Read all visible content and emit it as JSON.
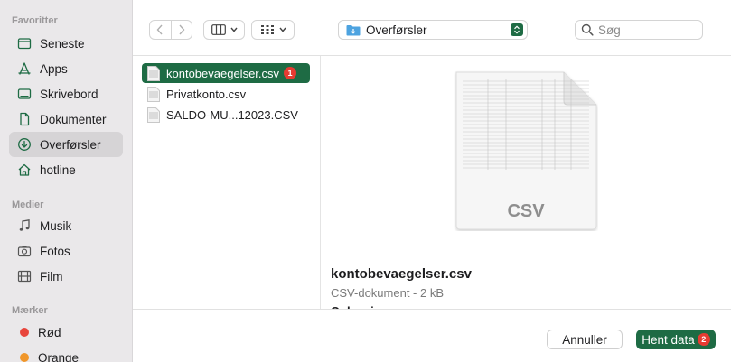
{
  "sidebar": {
    "favorites_heading": "Favoritter",
    "favorites": [
      {
        "label": "Seneste",
        "icon": "clock-folder-icon"
      },
      {
        "label": "Apps",
        "icon": "apps-icon"
      },
      {
        "label": "Skrivebord",
        "icon": "desktop-icon"
      },
      {
        "label": "Dokumenter",
        "icon": "document-icon"
      },
      {
        "label": "Overførsler",
        "icon": "downloads-icon",
        "selected": true
      },
      {
        "label": "hotline",
        "icon": "home-icon"
      }
    ],
    "media_heading": "Medier",
    "media": [
      {
        "label": "Musik",
        "icon": "music-icon"
      },
      {
        "label": "Fotos",
        "icon": "camera-icon"
      },
      {
        "label": "Film",
        "icon": "film-icon"
      }
    ],
    "tags_heading": "Mærker",
    "tags": [
      {
        "label": "Rød",
        "color": "#e8453c"
      },
      {
        "label": "Orange",
        "color": "#f0962a"
      }
    ]
  },
  "toolbar": {
    "back_icon": "chevron-left-icon",
    "forward_icon": "chevron-right-icon",
    "location": "Overførsler",
    "search_placeholder": "Søg"
  },
  "files": [
    {
      "name": "kontobevaegelser.csv",
      "selected": true,
      "badge": "1"
    },
    {
      "name": "Privatkonto.csv",
      "selected": false
    },
    {
      "name": "SALDO-MU...12023.CSV",
      "selected": false
    }
  ],
  "preview": {
    "doc_label": "CSV",
    "name": "kontobevaegelser.csv",
    "kind": "CSV-dokument - 2 kB",
    "partial_text": "Oplysninger"
  },
  "buttons": {
    "cancel": "Annuller",
    "open": "Hent data",
    "open_badge": "2"
  },
  "colors": {
    "accent": "#1e6b44",
    "badge": "#e63b32"
  }
}
